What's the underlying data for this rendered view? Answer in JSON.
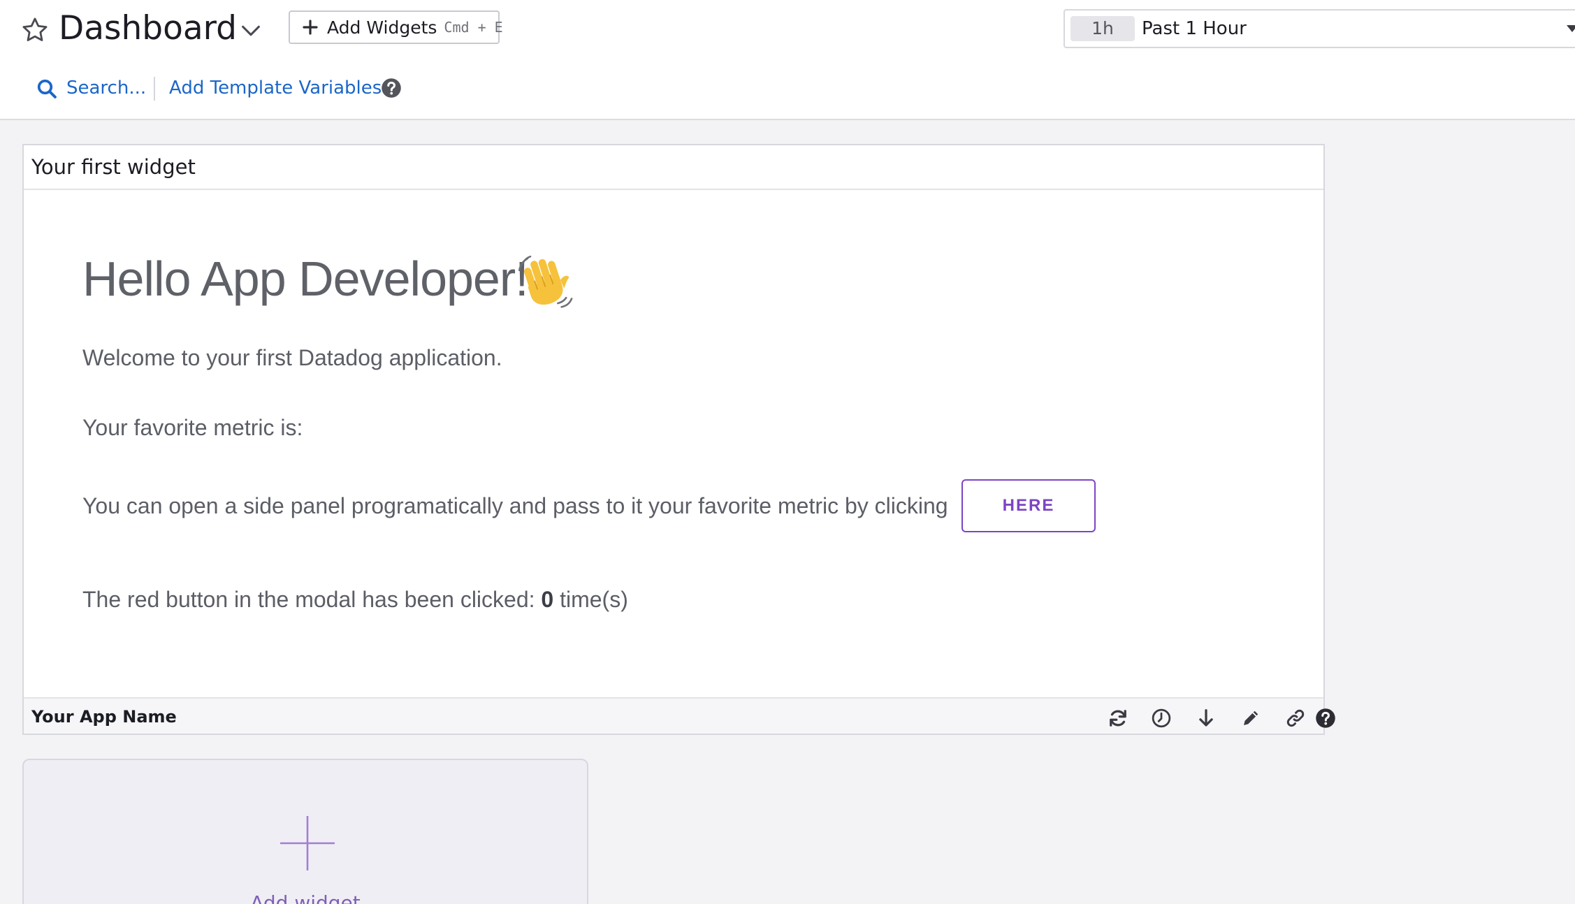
{
  "header": {
    "title": "Dashboard",
    "add_widgets": {
      "label": "Add Widgets",
      "shortcut": "Cmd + E"
    },
    "time_picker": {
      "badge": "1h",
      "label": "Past 1 Hour"
    },
    "search_label": "Search...",
    "template_variables_label": "Add Template Variables"
  },
  "widget": {
    "title": "Your first widget",
    "heading": "Hello App Developer!",
    "welcome_text": "Welcome to your first Datadog application.",
    "favorite_metric_text": "Your favorite metric is:",
    "side_panel_text": "You can open a side panel programatically and pass to it your favorite metric by clicking",
    "here_button_label": "HERE",
    "red_button_prefix": "The red button in the modal has been clicked: ",
    "red_button_count": "0",
    "red_button_suffix": " time(s)",
    "app_name": "Your App Name",
    "footer_icons": [
      "refresh-icon",
      "clock-icon",
      "download-icon",
      "pencil-icon",
      "link-icon",
      "help-icon"
    ]
  },
  "add_widget_card": {
    "label": "Add widget"
  },
  "colors": {
    "link": "#1b66c9",
    "accent_purple": "#7c45c4",
    "body_text": "#5c5e66",
    "page_background": "#f3f3f5"
  }
}
